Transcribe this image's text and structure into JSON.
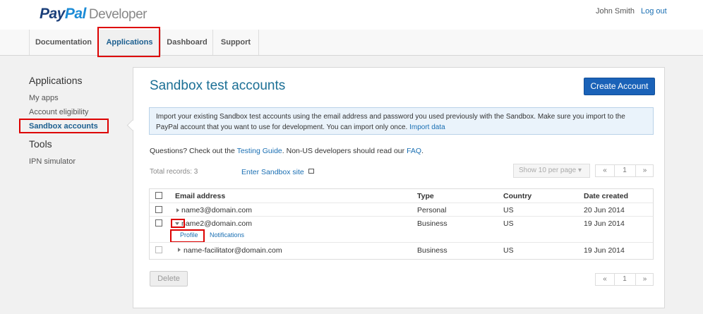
{
  "header": {
    "logo_brand": "PayPal",
    "logo_brand_a": "Pay",
    "logo_brand_b": "Pal",
    "logo_suffix": "Developer",
    "user_name": "John Smith",
    "logout_label": "Log out"
  },
  "nav": {
    "items": [
      {
        "label": "Documentation"
      },
      {
        "label": "Applications"
      },
      {
        "label": "Dashboard"
      },
      {
        "label": "Support"
      }
    ],
    "active": "Applications"
  },
  "sidebar": {
    "section_apps": "Applications",
    "items": [
      {
        "label": "My apps"
      },
      {
        "label": "Account eligibility"
      },
      {
        "label": "Sandbox accounts"
      }
    ],
    "section_tools": "Tools",
    "tools_items": [
      {
        "label": "IPN simulator"
      }
    ]
  },
  "main": {
    "title": "Sandbox test accounts",
    "create_button": "Create Account",
    "info_text": "Import your existing Sandbox test accounts using the email address and password you used previously with the Sandbox. Make sure you import to the PayPal account that you want to use for development. You can import only once.",
    "import_link": "Import data",
    "questions_prefix": "Questions? Check out the",
    "testing_guide_link": "Testing Guide",
    "questions_middle": ". Non-US developers should read our",
    "faq_link": "FAQ",
    "questions_suffix": ".",
    "total_records": "Total records: 3",
    "enter_sandbox_link": "Enter Sandbox site",
    "per_page": "Show 10 per page",
    "pager": {
      "prev": "«",
      "page": "1",
      "next": "»"
    },
    "table": {
      "headers": [
        "Email address",
        "Type",
        "Country",
        "Date created"
      ],
      "rows": [
        {
          "email": "name3@domain.com",
          "type": "Personal",
          "country": "US",
          "date": "20 Jun 2014"
        },
        {
          "email": "name2@domain.com",
          "type": "Business",
          "country": "US",
          "date": "19 Jun 2014"
        },
        {
          "email": "name-facilitator@domain.com",
          "type": "Business",
          "country": "US",
          "date": "19 Jun 2014"
        }
      ],
      "subtabs": [
        "Profile",
        "Notifications"
      ]
    },
    "delete_button": "Delete"
  },
  "colors": {
    "accent": "#1a62b8",
    "link": "#1a6fb3",
    "highlight": "#dd0000"
  }
}
